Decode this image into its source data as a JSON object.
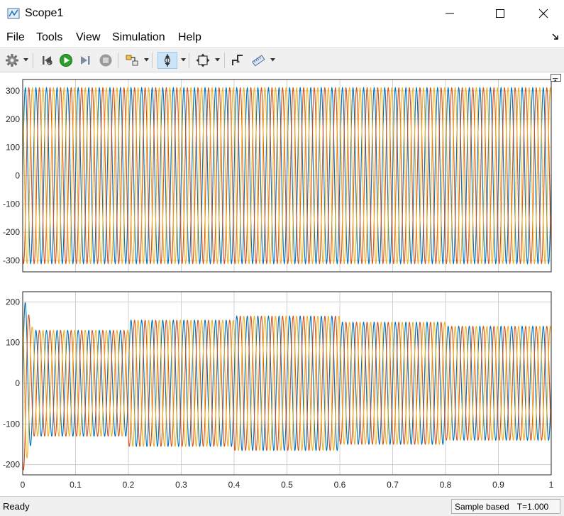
{
  "window": {
    "title": "Scope1",
    "minimize_icon": "minimize-icon",
    "maximize_icon": "maximize-icon",
    "close_icon": "close-icon"
  },
  "menu": [
    "File",
    "Tools",
    "View",
    "Simulation",
    "Help"
  ],
  "toolbar": {
    "buttons": [
      {
        "name": "configuration-gear-icon",
        "dropdown": true
      },
      {
        "name": "step-back-icon",
        "dropdown": false
      },
      {
        "name": "run-icon",
        "dropdown": false
      },
      {
        "name": "step-forward-icon",
        "dropdown": false
      },
      {
        "name": "stop-icon",
        "dropdown": false
      },
      {
        "name": "highlight-simulink-block-icon",
        "dropdown": true
      },
      {
        "name": "zoom-in-icon",
        "dropdown": true,
        "active": true
      },
      {
        "name": "scale-axes-icon",
        "dropdown": true
      },
      {
        "name": "triggers-icon",
        "dropdown": false
      },
      {
        "name": "cursor-measurements-icon",
        "dropdown": true
      }
    ]
  },
  "colors": {
    "series": [
      "#0072BD",
      "#D95319",
      "#EDB120"
    ],
    "grid": "#d0d0d0",
    "axes_border": "#262626",
    "run_button": "#2ca02c"
  },
  "chart_data": [
    {
      "type": "line",
      "title": "",
      "xlabel": "",
      "ylabel": "",
      "xlim": [
        0,
        1
      ],
      "ylim": [
        -340,
        340
      ],
      "xticks": [
        0,
        0.1,
        0.2,
        0.3,
        0.4,
        0.5,
        0.6,
        0.7,
        0.8,
        0.9,
        1
      ],
      "xtick_labels_shown": false,
      "yticks": [
        -300,
        -200,
        -100,
        0,
        100,
        200,
        300
      ],
      "ytick_labels": [
        "-300",
        "-200",
        "-100",
        "0",
        "100",
        "200",
        "300"
      ],
      "grid": true,
      "frequency_hz": 50,
      "series": [
        {
          "amplitude": 311,
          "phase_deg": 0,
          "color": "#0072BD"
        },
        {
          "amplitude": 311,
          "phase_deg": -120,
          "color": "#D95319"
        },
        {
          "amplitude": 311,
          "phase_deg": 120,
          "color": "#EDB120"
        }
      ]
    },
    {
      "type": "line",
      "title": "",
      "xlabel": "",
      "ylabel": "",
      "xlim": [
        0,
        1
      ],
      "ylim": [
        -225,
        225
      ],
      "xticks": [
        0,
        0.1,
        0.2,
        0.3,
        0.4,
        0.5,
        0.6,
        0.7,
        0.8,
        0.9,
        1
      ],
      "xtick_labels": [
        "0",
        "0.1",
        "0.2",
        "0.3",
        "0.4",
        "0.5",
        "0.6",
        "0.7",
        "0.8",
        "0.9",
        "1"
      ],
      "yticks": [
        -200,
        -100,
        0,
        100,
        200
      ],
      "ytick_labels": [
        "-200",
        "-100",
        "0",
        "100",
        "200"
      ],
      "grid": true,
      "frequency_hz": 50,
      "amplitude_segments": [
        {
          "t_start": 0.02,
          "t_end": 0.2,
          "amplitude": 130
        },
        {
          "t_start": 0.2,
          "t_end": 0.4,
          "amplitude": 155
        },
        {
          "t_start": 0.4,
          "t_end": 0.6,
          "amplitude": 165
        },
        {
          "t_start": 0.6,
          "t_end": 0.8,
          "amplitude": 150
        },
        {
          "t_start": 0.8,
          "t_end": 1.0,
          "amplitude": 140
        }
      ],
      "startup_transient_peak": 220,
      "series": [
        {
          "phase_deg": 0,
          "color": "#0072BD"
        },
        {
          "phase_deg": -120,
          "color": "#D95319"
        },
        {
          "phase_deg": 120,
          "color": "#EDB120"
        }
      ]
    }
  ],
  "status": {
    "left": "Ready",
    "mode": "Sample based",
    "time": "T=1.000"
  }
}
